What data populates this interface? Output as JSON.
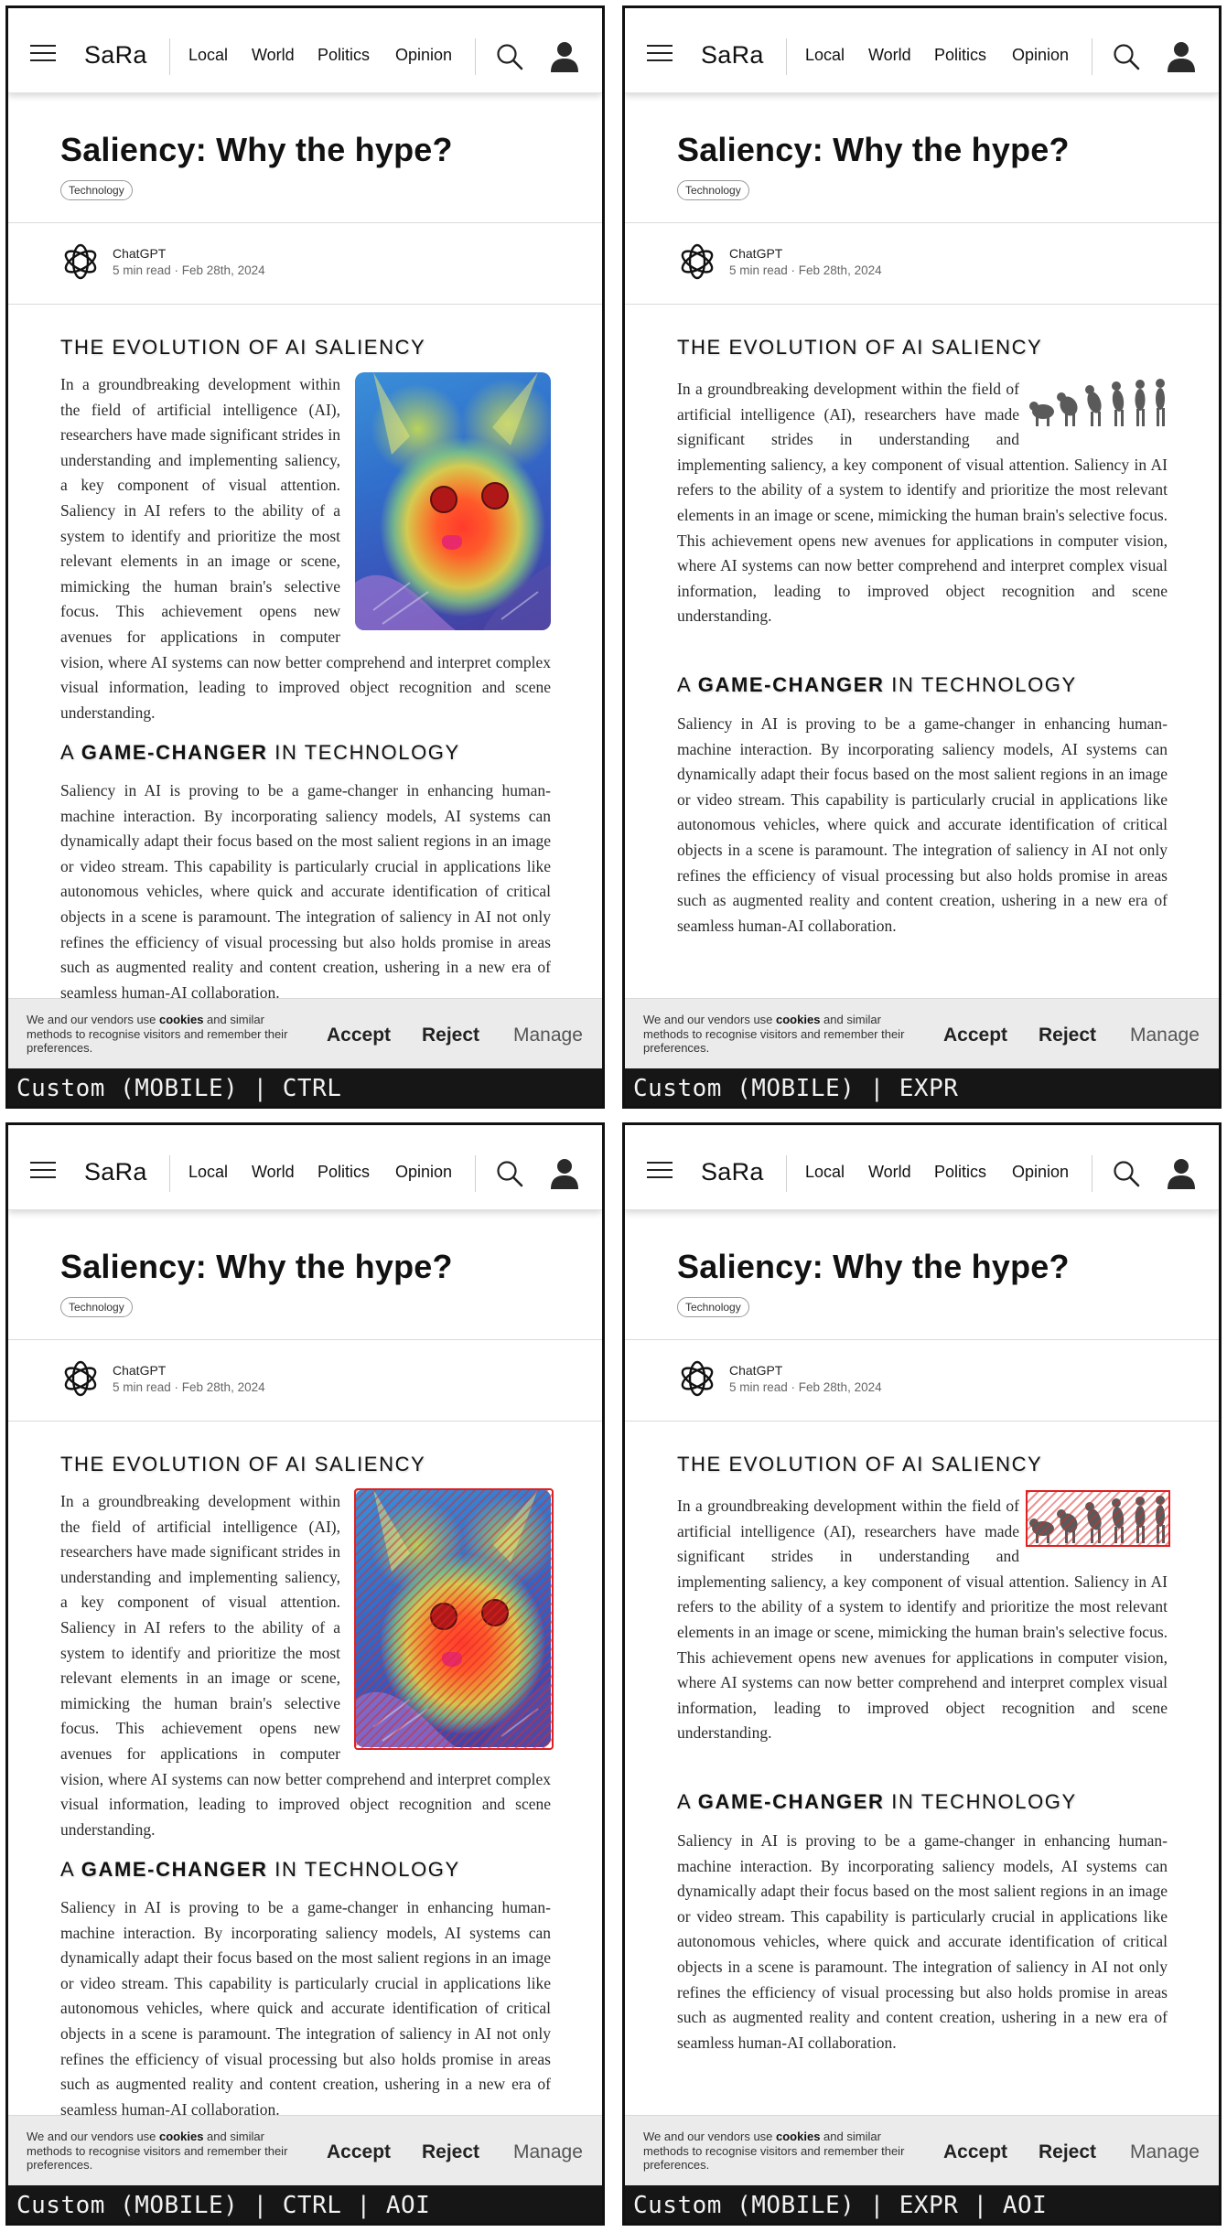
{
  "nav": {
    "logo": "SaRa",
    "links": [
      "Local",
      "World",
      "Politics",
      "Opinion"
    ]
  },
  "article": {
    "title": "Saliency: Why the hype?",
    "tag": "Technology",
    "author": "ChatGPT",
    "meta": "5 min read · Feb 28th, 2024",
    "section1_heading": "THE EVOLUTION OF AI SALIENCY",
    "section1_body": "In a groundbreaking development within the field of artificial intelligence (AI), researchers have made significant strides in understanding and implementing saliency, a key component of visual attention. Saliency in AI refers to the ability of a system to identify and prioritize the most relevant elements in an image or scene, mimicking the human brain's selective focus. This achievement opens new avenues for applications in computer vision, where AI systems can now better comprehend and interpret complex visual information, leading to improved object recognition and scene understanding.",
    "section2_heading_pre": "A ",
    "section2_heading_bold": "GAME-CHANGER",
    "section2_heading_post": " IN TECHNOLOGY",
    "section2_body": "Saliency in AI is proving to be a game-changer in enhancing human-machine interaction. By incorporating saliency models, AI systems can dynamically adapt their focus based on the most salient regions in an image or video stream. This capability is particularly crucial in applications like autonomous vehicles, where quick and accurate identification of critical objects in a scene is paramount. The integration of saliency in AI not only refines the efficiency of visual processing but also holds promise in areas such as augmented reality and content creation, ushering in a new era of seamless human-AI collaboration."
  },
  "cookie": {
    "text_pre": "We and our vendors use ",
    "text_bold": "cookies",
    "text_post": " and similar methods to recognise visitors and remember their preferences.",
    "accept": "Accept",
    "reject": "Reject",
    "manage": "Manage"
  },
  "panels": [
    {
      "label": "Custom (MOBILE) | CTRL",
      "image": "cat-heatmap"
    },
    {
      "label": "Custom (MOBILE) | EXPR",
      "image": "evolution-silhouettes"
    },
    {
      "label": "Custom (MOBILE) | CTRL | AOI",
      "image": "cat-heatmap",
      "aoi": true
    },
    {
      "label": "Custom (MOBILE) | EXPR | AOI",
      "image": "evolution-silhouettes",
      "aoi": true
    }
  ],
  "icons": [
    "menu-icon",
    "search-icon",
    "user-icon",
    "openai-logo-icon"
  ],
  "colors": {
    "aoi_outline": "#e02020",
    "label_bar": "#161616",
    "cookie_bar": "#ebebeb"
  }
}
